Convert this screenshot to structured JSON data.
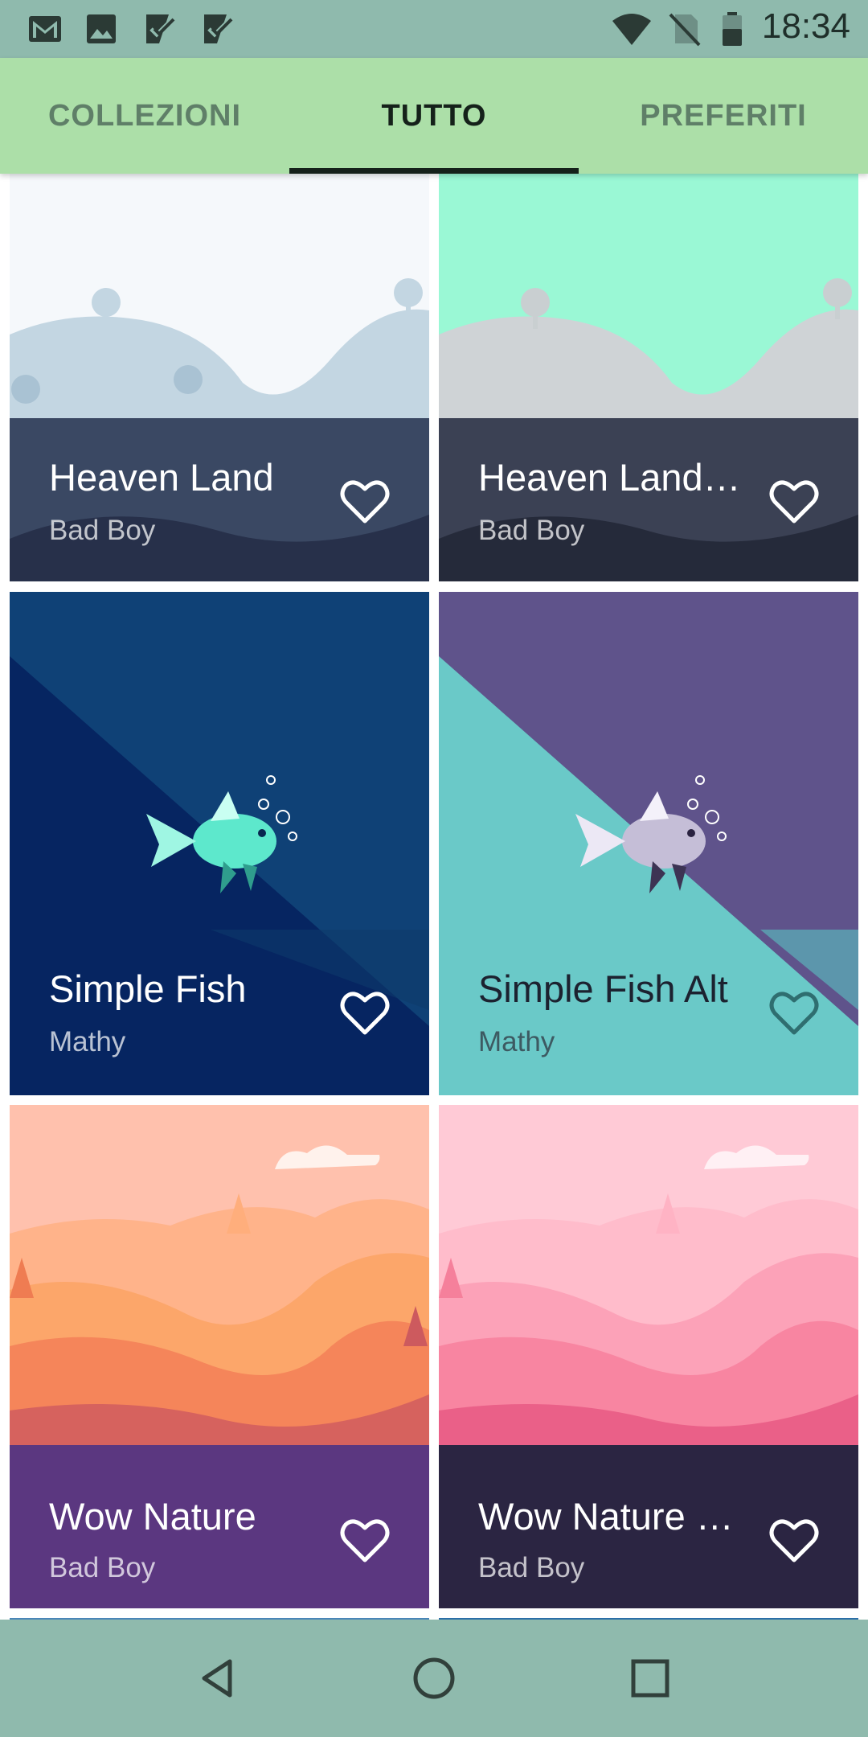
{
  "status_bar": {
    "time": "18:34",
    "left_icons": [
      "gmail-icon",
      "gallery-icon",
      "task-check-icon",
      "task-check-icon"
    ],
    "right_icons": [
      "wifi-icon",
      "no-sim-icon",
      "battery-icon"
    ]
  },
  "tabs": [
    {
      "label": "COLLEZIONI",
      "active": false
    },
    {
      "label": "TUTTO",
      "active": true
    },
    {
      "label": "PREFERITI",
      "active": false
    }
  ],
  "wallpapers": [
    {
      "title": "Heaven Land",
      "author": "Bad Boy",
      "favorite": false
    },
    {
      "title": "Heaven Land …",
      "author": "Bad Boy",
      "favorite": false
    },
    {
      "title": "Simple Fish",
      "author": "Mathy",
      "favorite": false
    },
    {
      "title": "Simple Fish Alt",
      "author": "Mathy",
      "favorite": false
    },
    {
      "title": "Wow Nature",
      "author": "Bad Boy",
      "favorite": false
    },
    {
      "title": "Wow Nature …",
      "author": "Bad Boy",
      "favorite": false
    }
  ],
  "nav_bar": {
    "buttons": [
      "back-icon",
      "home-icon",
      "recents-icon"
    ]
  },
  "colors": {
    "status_bar": "#8fbaad",
    "tab_bar": "#acdfa8",
    "tab_active": "#15211a",
    "tab_inactive": "#5f7f68"
  }
}
